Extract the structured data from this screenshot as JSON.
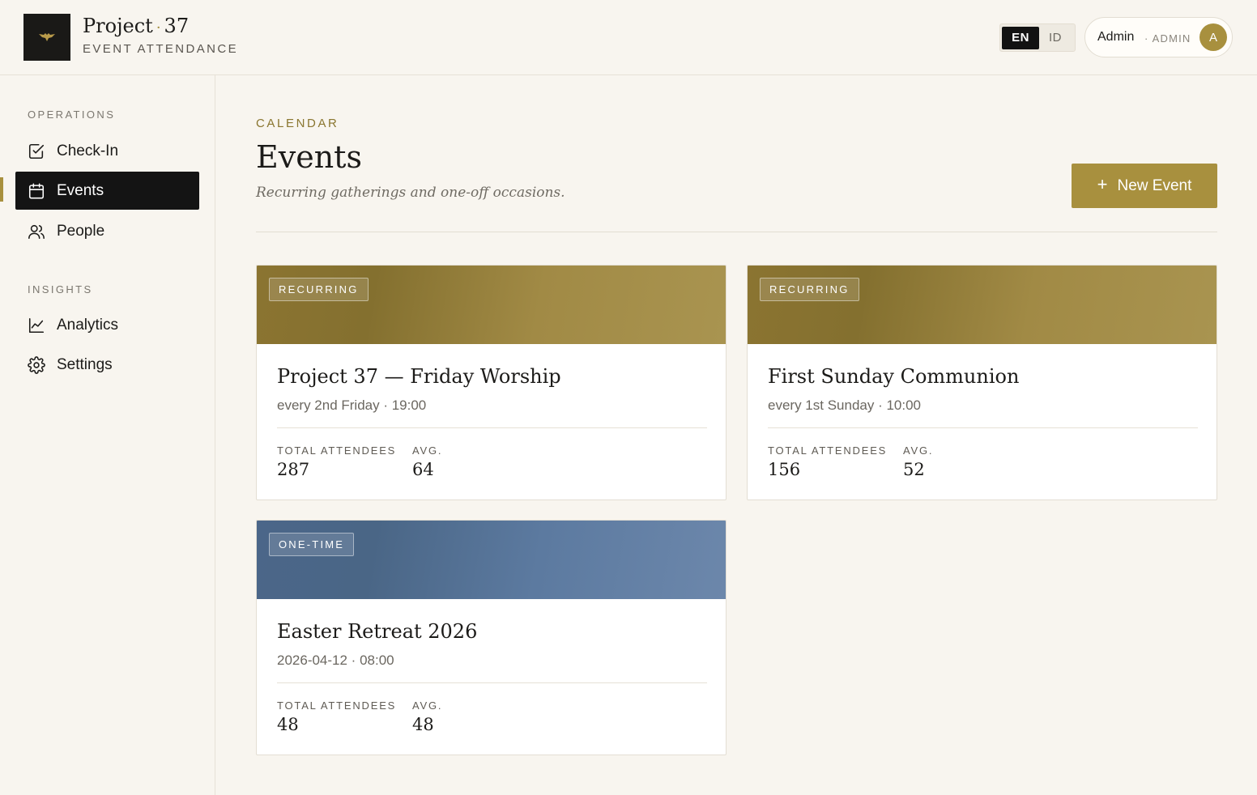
{
  "header": {
    "brand_name": "Project",
    "brand_dot": "·",
    "brand_number": "37",
    "brand_subtitle": "EVENT ATTENDANCE",
    "lang_options": [
      "EN",
      "ID"
    ],
    "lang_selected": "EN",
    "user_name": "Admin",
    "user_role": "· ADMIN",
    "user_initial": "A"
  },
  "sidebar": {
    "sections": [
      {
        "label": "OPERATIONS",
        "items": [
          {
            "label": "Check-In",
            "icon": "check-square-icon",
            "active": false
          },
          {
            "label": "Events",
            "icon": "calendar-icon",
            "active": true
          },
          {
            "label": "People",
            "icon": "users-icon",
            "active": false
          }
        ]
      },
      {
        "label": "INSIGHTS",
        "items": [
          {
            "label": "Analytics",
            "icon": "line-chart-icon",
            "active": false
          },
          {
            "label": "Settings",
            "icon": "gear-icon",
            "active": false
          }
        ]
      }
    ]
  },
  "main": {
    "eyebrow": "CALENDAR",
    "title": "Events",
    "subtitle": "Recurring gatherings and one-off occasions.",
    "new_button_icon": "+",
    "new_button_label": "New Event",
    "stat_labels": {
      "total": "TOTAL ATTENDEES",
      "avg": "AVG."
    },
    "events": [
      {
        "badge": "RECURRING",
        "title": "Project 37 — Friday Worship",
        "schedule": "every 2nd Friday · 19:00",
        "total": "287",
        "avg": "64",
        "color": "#8b7431"
      },
      {
        "badge": "RECURRING",
        "title": "First Sunday Communion",
        "schedule": "every 1st Sunday · 10:00",
        "total": "156",
        "avg": "52",
        "color": "#8b7431"
      },
      {
        "badge": "ONE-TIME",
        "title": "Easter Retreat 2026",
        "schedule": "2026-04-12 · 08:00",
        "total": "48",
        "avg": "48",
        "color": "#4b6689"
      }
    ]
  },
  "colors": {
    "accent": "#a8903e",
    "background": "#f8f5ef",
    "active_nav": "#141414"
  }
}
